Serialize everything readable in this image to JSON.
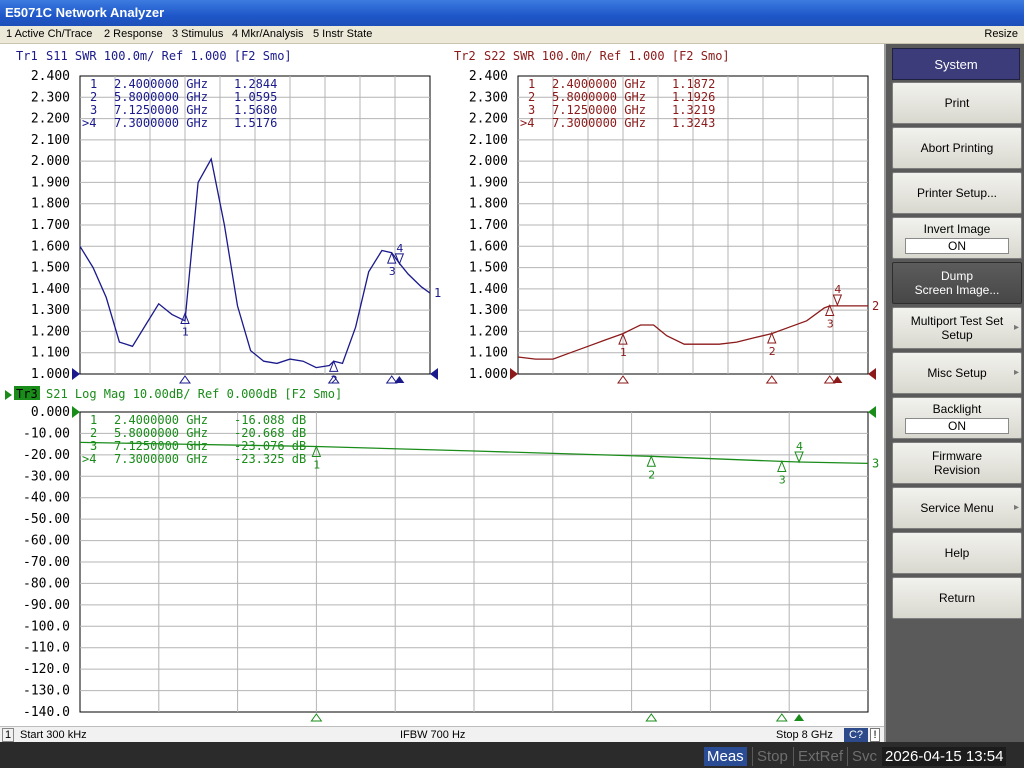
{
  "window": {
    "title": "E5071C Network Analyzer"
  },
  "menu": {
    "items": [
      "1 Active Ch/Trace",
      "2 Response",
      "3 Stimulus",
      "4 Mkr/Analysis",
      "5 Instr State"
    ],
    "resize": "Resize"
  },
  "colors": {
    "tr1": "#1a1a8c",
    "tr2": "#8c1a1a",
    "tr3": "#1a8c1a"
  },
  "traces": {
    "tr1": {
      "header_id": "Tr1",
      "header_rest": "S11  SWR 100.0m/  Ref 1.000  [F2 Smo]",
      "y_ticks": [
        "2.400",
        "2.300",
        "2.200",
        "2.100",
        "2.000",
        "1.900",
        "1.800",
        "1.700",
        "1.600",
        "1.500",
        "1.400",
        "1.300",
        "1.200",
        "1.100",
        "1.000"
      ],
      "marker_table": [
        {
          "id": "1",
          "freq": "2.4000000 GHz",
          "value": "1.2844"
        },
        {
          "id": "2",
          "freq": "5.8000000 GHz",
          "value": "1.0595"
        },
        {
          "id": "3",
          "freq": "7.1250000 GHz",
          "value": "1.5680"
        },
        {
          "id": ">4",
          "freq": "7.3000000 GHz",
          "value": "1.5176"
        }
      ],
      "end_label": "1"
    },
    "tr2": {
      "header_id": "Tr2",
      "header_rest": "S22  SWR 100.0m/  Ref 1.000  [F2 Smo]",
      "y_ticks": [
        "2.400",
        "2.300",
        "2.200",
        "2.100",
        "2.000",
        "1.900",
        "1.800",
        "1.700",
        "1.600",
        "1.500",
        "1.400",
        "1.300",
        "1.200",
        "1.100",
        "1.000"
      ],
      "marker_table": [
        {
          "id": "1",
          "freq": "2.4000000 GHz",
          "value": "1.1872"
        },
        {
          "id": "2",
          "freq": "5.8000000 GHz",
          "value": "1.1926"
        },
        {
          "id": "3",
          "freq": "7.1250000 GHz",
          "value": "1.3219"
        },
        {
          "id": ">4",
          "freq": "7.3000000 GHz",
          "value": "1.3243"
        }
      ],
      "end_label": "2"
    },
    "tr3": {
      "header_id": "Tr3",
      "header_rest": "S21  Log Mag 10.00dB/  Ref 0.000dB  [F2 Smo]",
      "y_ticks": [
        "0.000",
        "-10.00",
        "-20.00",
        "-30.00",
        "-40.00",
        "-50.00",
        "-60.00",
        "-70.00",
        "-80.00",
        "-90.00",
        "-100.0",
        "-110.0",
        "-120.0",
        "-130.0",
        "-140.0"
      ],
      "marker_table": [
        {
          "id": "1",
          "freq": "2.4000000 GHz",
          "value": "-16.088 dB"
        },
        {
          "id": "2",
          "freq": "5.8000000 GHz",
          "value": "-20.668 dB"
        },
        {
          "id": "3",
          "freq": "7.1250000 GHz",
          "value": "-23.076 dB"
        },
        {
          "id": ">4",
          "freq": "7.3000000 GHz",
          "value": "-23.325 dB"
        }
      ],
      "end_label": "3"
    }
  },
  "chart_data": [
    {
      "type": "line",
      "title": "Tr1 S11 SWR 100.0m/ Ref 1.000 [F2 Smo]",
      "ylim": [
        1.0,
        2.4
      ],
      "xlim": [
        0.0003,
        8
      ],
      "series": [
        {
          "name": "Tr1",
          "x": [
            0.0003,
            0.3,
            0.6,
            0.9,
            1.2,
            1.5,
            1.8,
            2.1,
            2.4,
            2.7,
            3.0,
            3.3,
            3.6,
            3.9,
            4.2,
            4.5,
            4.8,
            5.1,
            5.4,
            5.7,
            5.8,
            6.0,
            6.3,
            6.6,
            6.9,
            7.125,
            7.3,
            7.5,
            7.8,
            8.0
          ],
          "y": [
            1.6,
            1.5,
            1.36,
            1.15,
            1.13,
            1.23,
            1.33,
            1.28,
            1.25,
            1.9,
            2.01,
            1.7,
            1.32,
            1.11,
            1.06,
            1.05,
            1.07,
            1.06,
            1.03,
            1.04,
            1.06,
            1.05,
            1.22,
            1.48,
            1.58,
            1.57,
            1.52,
            1.47,
            1.41,
            1.38
          ]
        }
      ],
      "markers": [
        {
          "id": "1",
          "x": 2.4,
          "y": 1.2844
        },
        {
          "id": "2",
          "x": 5.8,
          "y": 1.0595
        },
        {
          "id": "3",
          "x": 7.125,
          "y": 1.568
        },
        {
          "id": "4",
          "x": 7.3,
          "y": 1.5176
        }
      ]
    },
    {
      "type": "line",
      "title": "Tr2 S22 SWR 100.0m/ Ref 1.000 [F2 Smo]",
      "ylim": [
        1.0,
        2.4
      ],
      "xlim": [
        0.0003,
        8
      ],
      "series": [
        {
          "name": "Tr2",
          "x": [
            0.0003,
            0.4,
            0.8,
            1.2,
            1.6,
            2.0,
            2.4,
            2.8,
            3.1,
            3.4,
            3.8,
            4.2,
            4.6,
            5.0,
            5.4,
            5.8,
            6.2,
            6.6,
            7.0,
            7.125,
            7.3,
            7.6,
            8.0
          ],
          "y": [
            1.08,
            1.07,
            1.07,
            1.1,
            1.13,
            1.16,
            1.19,
            1.23,
            1.23,
            1.18,
            1.14,
            1.14,
            1.14,
            1.15,
            1.17,
            1.19,
            1.22,
            1.25,
            1.31,
            1.32,
            1.32,
            1.32,
            1.32
          ]
        }
      ],
      "markers": [
        {
          "id": "1",
          "x": 2.4,
          "y": 1.1872
        },
        {
          "id": "2",
          "x": 5.8,
          "y": 1.1926
        },
        {
          "id": "3",
          "x": 7.125,
          "y": 1.3219
        },
        {
          "id": "4",
          "x": 7.3,
          "y": 1.3243
        }
      ]
    },
    {
      "type": "line",
      "title": "Tr3 S21 Log Mag 10.00dB/ Ref 0.000dB [F2 Smo]",
      "ylim": [
        -140,
        0
      ],
      "xlim": [
        0.0003,
        8
      ],
      "series": [
        {
          "name": "Tr3",
          "x": [
            0.0003,
            1.0,
            2.4,
            4.0,
            5.8,
            7.125,
            7.3,
            8.0
          ],
          "y": [
            -14.2,
            -15.0,
            -16.088,
            -18.2,
            -20.668,
            -23.076,
            -23.325,
            -24.0
          ]
        }
      ],
      "markers": [
        {
          "id": "1",
          "x": 2.4,
          "y": -16.088
        },
        {
          "id": "2",
          "x": 5.8,
          "y": -20.668
        },
        {
          "id": "3",
          "x": 7.125,
          "y": -23.076
        },
        {
          "id": "4",
          "x": 7.3,
          "y": -23.325
        }
      ]
    }
  ],
  "status": {
    "channel": "1",
    "start": "Start 300 kHz",
    "ifbw": "IFBW 700 Hz",
    "stop": "Stop 8 GHz",
    "cal": "C?",
    "excl": "!"
  },
  "statusbar": {
    "meas": "Meas",
    "stop": "Stop",
    "extref": "ExtRef",
    "svc": "Svc",
    "datetime": "2026-04-15 13:54"
  },
  "softkeys": {
    "title": "System",
    "print": "Print",
    "abort": "Abort Printing",
    "printer_setup": "Printer Setup...",
    "invert_label": "Invert Image",
    "invert_value": "ON",
    "dump_line1": "Dump",
    "dump_line2": "Screen Image...",
    "multiport_line1": "Multiport Test Set",
    "multiport_line2": "Setup",
    "misc": "Misc Setup",
    "backlight_label": "Backlight",
    "backlight_value": "ON",
    "firmware_line1": "Firmware",
    "firmware_line2": "Revision",
    "service": "Service Menu",
    "help": "Help",
    "return": "Return"
  }
}
